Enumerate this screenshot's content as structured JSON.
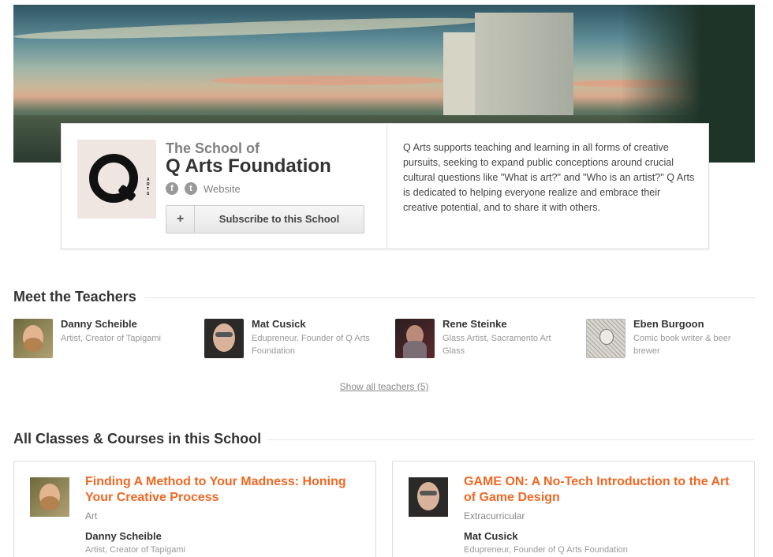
{
  "school": {
    "prefix": "The School of",
    "name": "Q Arts Foundation",
    "logo_text": "ARTS",
    "website_label": "Website",
    "facebook_icon": "f",
    "twitter_icon": "t",
    "subscribe_plus": "+",
    "subscribe_label": "Subscribe to this School",
    "description": "Q Arts supports teaching and learning in all forms of creative pursuits, seeking to expand public conceptions around crucial cultural questions like \"What is art?\" and \"Who is an artist?\" Q Arts is dedicated to helping everyone realize and embrace their creative potential, and to share it with others."
  },
  "teachers_section": {
    "title": "Meet the Teachers",
    "show_all": "Show all teachers (5)",
    "teachers": [
      {
        "name": "Danny Scheible",
        "role": "Artist, Creator of Tapigami"
      },
      {
        "name": "Mat Cusick",
        "role": "Edupreneur, Founder of Q Arts Foundation"
      },
      {
        "name": "Rene Steinke",
        "role": "Glass Artist, Sacramento Art Glass"
      },
      {
        "name": "Eben Burgoon",
        "role": "Comic book writer & beer brewer"
      }
    ]
  },
  "classes_section": {
    "title": "All Classes & Courses in this School",
    "classes": [
      {
        "title": "Finding A Method to Your Madness: Honing Your Creative Process",
        "category": "Art",
        "teacher": "Danny Scheible",
        "role": "Artist, Creator of Tapigami"
      },
      {
        "title": "GAME ON: A No-Tech Introduction to the Art of Game Design",
        "category": "Extracurricular",
        "teacher": "Mat Cusick",
        "role": "Edupreneur, Founder of Q Arts Foundation"
      }
    ]
  },
  "colors": {
    "accent": "#f26722",
    "muted": "#999999"
  }
}
